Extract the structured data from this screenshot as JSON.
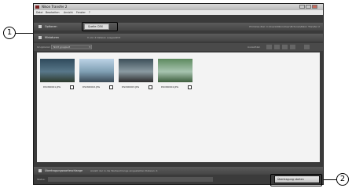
{
  "window": {
    "title": "Nikon Transfer 2"
  },
  "menu": {
    "items": [
      "Datei",
      "Bearbeiten",
      "Ansicht",
      "Fenster",
      "?"
    ]
  },
  "options_bar": {
    "label": "Optionen",
    "source_label": "Quelle: D5X",
    "target_info": "Primäres Ziel: C:\\Users\\Nikon\\User\\Pictures\\Nikon Transfer 2"
  },
  "thumbnail_bar": {
    "label": "Miniaturen",
    "count_text": "0 von 4 Dateien ausgewählt",
    "group_label": "Gruppieren",
    "group_value": "Nicht gruppiert",
    "select_label": "Auswählen"
  },
  "thumbnails": [
    {
      "filename": "DSCN0001.JPG"
    },
    {
      "filename": "DSCN0002.JPG"
    },
    {
      "filename": "DSCN0003.JPG"
    },
    {
      "filename": "DSCN0004.JPG"
    }
  ],
  "transfer_queue": {
    "label": "Übertragungswarteschlange",
    "info": "Anzahl der in die Warteschlange eingestellten Dateien: 4"
  },
  "status": {
    "label": "Status:"
  },
  "actions": {
    "start_transfer": "Übertragung starten"
  },
  "callouts": {
    "one": "1",
    "two": "2"
  }
}
